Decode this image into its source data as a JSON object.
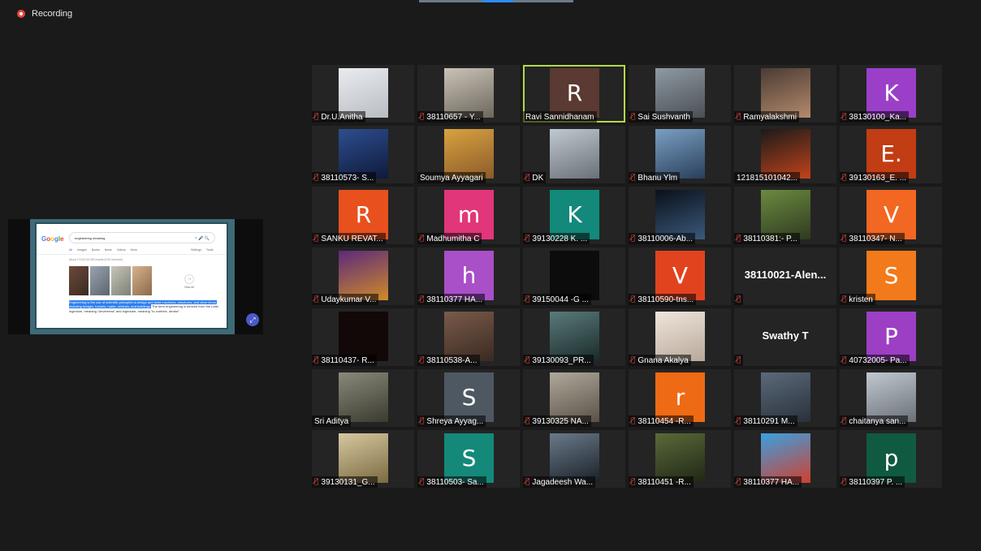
{
  "recording": {
    "label": "Recording"
  },
  "share": {
    "logo": [
      "G",
      "o",
      "o",
      "g",
      "l",
      "e"
    ],
    "search_query": "engineering meaning",
    "search_icons": "×  🎤  🔍",
    "tabs": [
      "All",
      "Images",
      "Books",
      "News",
      "Videos",
      "More"
    ],
    "tabs_right": [
      "Settings",
      "Tools"
    ],
    "stats": "About 170,00,00,000 results (0.54 seconds)",
    "more_images": "View all",
    "snippet_highlight": "Engineering is the use of scientific principles to design and build machines, structures, and other items, including bridges, tunnels, roads, vehicles, and buildings.",
    "snippet_rest": " The term engineering is derived from the Latin ingenium, meaning \"cleverness\" and ingeniare, meaning \"to contrive, devise\"."
  },
  "participants": [
    {
      "name": "Dr.U.Anitha",
      "muted": true,
      "initial": "",
      "color": "",
      "photo": "p1"
    },
    {
      "name": "38110657 - Y...",
      "muted": true,
      "initial": "",
      "color": "",
      "photo": "p2"
    },
    {
      "name": "Ravi Sannidhanam",
      "muted": false,
      "initial": "R",
      "color": "#5a3a32",
      "photo": "",
      "active": true
    },
    {
      "name": "Sai Sushvanth",
      "muted": true,
      "initial": "",
      "color": "",
      "photo": "p3"
    },
    {
      "name": "Ramyalakshmi",
      "muted": true,
      "initial": "",
      "color": "",
      "photo": "p4"
    },
    {
      "name": "38130100_Ka...",
      "muted": true,
      "initial": "K",
      "color": "#9b3fc9",
      "photo": ""
    },
    {
      "name": "38110573- S...",
      "muted": true,
      "initial": "",
      "color": "",
      "photo": "p5"
    },
    {
      "name": "Soumya Ayyagari",
      "muted": false,
      "initial": "",
      "color": "",
      "photo": "p6"
    },
    {
      "name": "DK",
      "muted": true,
      "initial": "",
      "color": "",
      "photo": "p24"
    },
    {
      "name": "Bhanu Ylm",
      "muted": true,
      "initial": "",
      "color": "",
      "photo": "p7"
    },
    {
      "name": "121815101042...",
      "muted": false,
      "initial": "",
      "color": "",
      "photo": "p8"
    },
    {
      "name": "39130163_E. ...",
      "muted": true,
      "initial": "E.",
      "color": "#c23d14",
      "photo": ""
    },
    {
      "name": "SANKU REVAT...",
      "muted": true,
      "initial": "R",
      "color": "#e8501e",
      "photo": ""
    },
    {
      "name": "Madhumitha C",
      "muted": true,
      "initial": "m",
      "color": "#e2367a",
      "photo": ""
    },
    {
      "name": "39130228 K. ...",
      "muted": true,
      "initial": "K",
      "color": "#12897a",
      "photo": ""
    },
    {
      "name": "38110006-Ab...",
      "muted": true,
      "initial": "",
      "color": "",
      "photo": "p9"
    },
    {
      "name": "38110381:- P...",
      "muted": true,
      "initial": "",
      "color": "",
      "photo": "p10"
    },
    {
      "name": "38110347- N...",
      "muted": true,
      "initial": "V",
      "color": "#f26722",
      "photo": ""
    },
    {
      "name": "Udaykumar V...",
      "muted": true,
      "initial": "",
      "color": "",
      "photo": "p11"
    },
    {
      "name": "38110377 HA...",
      "muted": true,
      "initial": "h",
      "color": "#a94fc8",
      "photo": ""
    },
    {
      "name": "39150044 -G ...",
      "muted": true,
      "initial": "",
      "color": "",
      "photo": "p12"
    },
    {
      "name": "38110590-tns...",
      "muted": true,
      "initial": "V",
      "color": "#e2431f",
      "photo": ""
    },
    {
      "name": "",
      "muted": true,
      "initial": "",
      "color": "",
      "photo": "",
      "text": "38110021-Alen..."
    },
    {
      "name": "kristen",
      "muted": true,
      "initial": "S",
      "color": "#f27a1a",
      "photo": ""
    },
    {
      "name": "38110437- R...",
      "muted": true,
      "initial": "",
      "color": "",
      "photo": "p13"
    },
    {
      "name": "38110538-A...",
      "muted": true,
      "initial": "",
      "color": "",
      "photo": "p14"
    },
    {
      "name": "39130093_PR...",
      "muted": true,
      "initial": "",
      "color": "",
      "photo": "p15"
    },
    {
      "name": "Gnana Akalya",
      "muted": true,
      "initial": "",
      "color": "",
      "photo": "p16"
    },
    {
      "name": "",
      "muted": true,
      "initial": "",
      "color": "",
      "photo": "",
      "text": "Swathy T"
    },
    {
      "name": "40732005- Pa...",
      "muted": true,
      "initial": "P",
      "color": "#9c3fc4",
      "photo": ""
    },
    {
      "name": "Sri Aditya",
      "muted": false,
      "initial": "",
      "color": "",
      "photo": "p17"
    },
    {
      "name": "Shreya Ayyag...",
      "muted": true,
      "initial": "S",
      "color": "#4e5862",
      "photo": ""
    },
    {
      "name": "39130325 NA...",
      "muted": true,
      "initial": "",
      "color": "",
      "photo": "p18"
    },
    {
      "name": "38110454 -R...",
      "muted": true,
      "initial": "r",
      "color": "#ef6a14",
      "photo": ""
    },
    {
      "name": "38110291 M...",
      "muted": true,
      "initial": "",
      "color": "",
      "photo": "p19"
    },
    {
      "name": "chaitanya san...",
      "muted": true,
      "initial": "",
      "color": "",
      "photo": "p24"
    },
    {
      "name": "39130131_G...",
      "muted": true,
      "initial": "",
      "color": "",
      "photo": "p25"
    },
    {
      "name": "38110503- Sa...",
      "muted": true,
      "initial": "S",
      "color": "#14897a",
      "photo": ""
    },
    {
      "name": "Jagadeesh Wa...",
      "muted": true,
      "initial": "",
      "color": "",
      "photo": "p21"
    },
    {
      "name": "38110451 -R...",
      "muted": true,
      "initial": "",
      "color": "",
      "photo": "p22"
    },
    {
      "name": "38110377 HA...",
      "muted": true,
      "initial": "",
      "color": "",
      "photo": "p23"
    },
    {
      "name": "38110397 P. ...",
      "muted": true,
      "initial": "p",
      "color": "#0f5a40",
      "photo": ""
    }
  ]
}
